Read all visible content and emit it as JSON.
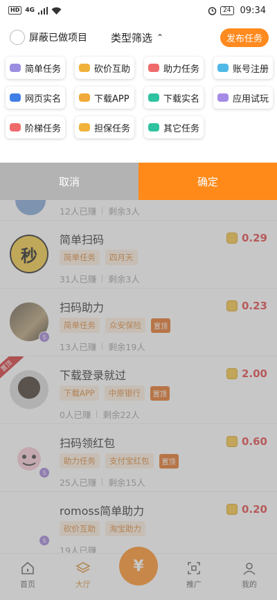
{
  "status_bar": {
    "hd": "HD",
    "signal": "4G",
    "battery": "24",
    "time": "09:34"
  },
  "filter": {
    "hide_done_label": "屏蔽已做项目",
    "type_filter_label": "类型筛选",
    "publish_label": "发布任务"
  },
  "categories": [
    {
      "label": "简单任务",
      "color": "#9b8ee0"
    },
    {
      "label": "砍价互助",
      "color": "#f0b23a"
    },
    {
      "label": "助力任务",
      "color": "#ef6b6b"
    },
    {
      "label": "账号注册",
      "color": "#4fb8e6"
    },
    {
      "label": "网页实名",
      "color": "#3f7fe6"
    },
    {
      "label": "下载APP",
      "color": "#f0a93a"
    },
    {
      "label": "下载实名",
      "color": "#2fc2a0"
    },
    {
      "label": "应用试玩",
      "color": "#a58ae6"
    },
    {
      "label": "阶梯任务",
      "color": "#ef6b6b"
    },
    {
      "label": "担保任务",
      "color": "#f0b23a"
    },
    {
      "label": "其它任务",
      "color": "#2fc2a0"
    }
  ],
  "actions": {
    "cancel_label": "取消",
    "confirm_label": "确定"
  },
  "partial_row": {
    "earned": "12人已赚",
    "remaining": "剩余3人"
  },
  "tasks": [
    {
      "title": "简单扫码",
      "reward": "0.29",
      "tags": [
        "简单任务",
        "四月天"
      ],
      "top": "",
      "earned": "31人已赚",
      "remaining": "剩余3人",
      "avatar_text": "秒"
    },
    {
      "title": "扫码助力",
      "reward": "0.23",
      "tags": [
        "简单任务",
        "众安保险"
      ],
      "top": "置顶",
      "earned": "13人已赚",
      "remaining": "剩余19人",
      "avatar_text": ""
    },
    {
      "title": "下载登录就过",
      "reward": "2.00",
      "tags": [
        "下载APP",
        "中原银行"
      ],
      "top": "置顶",
      "earned": "0人已赚",
      "remaining": "剩余22人",
      "avatar_text": "",
      "ribbon": "置顶"
    },
    {
      "title": "扫码领红包",
      "reward": "0.60",
      "tags": [
        "助力任务",
        "支付宝红包"
      ],
      "top": "置顶",
      "earned": "25人已赚",
      "remaining": "剩余15人",
      "avatar_text": ""
    },
    {
      "title": "romoss简单助力",
      "reward": "0.20",
      "tags": [
        "砍价互助",
        "淘宝助力"
      ],
      "top": "",
      "earned": "19人已赚",
      "remaining": "",
      "avatar_text": ""
    }
  ],
  "nav": {
    "home": "首页",
    "hall": "大厅",
    "center": "¥",
    "promote": "推广",
    "mine": "我的"
  }
}
